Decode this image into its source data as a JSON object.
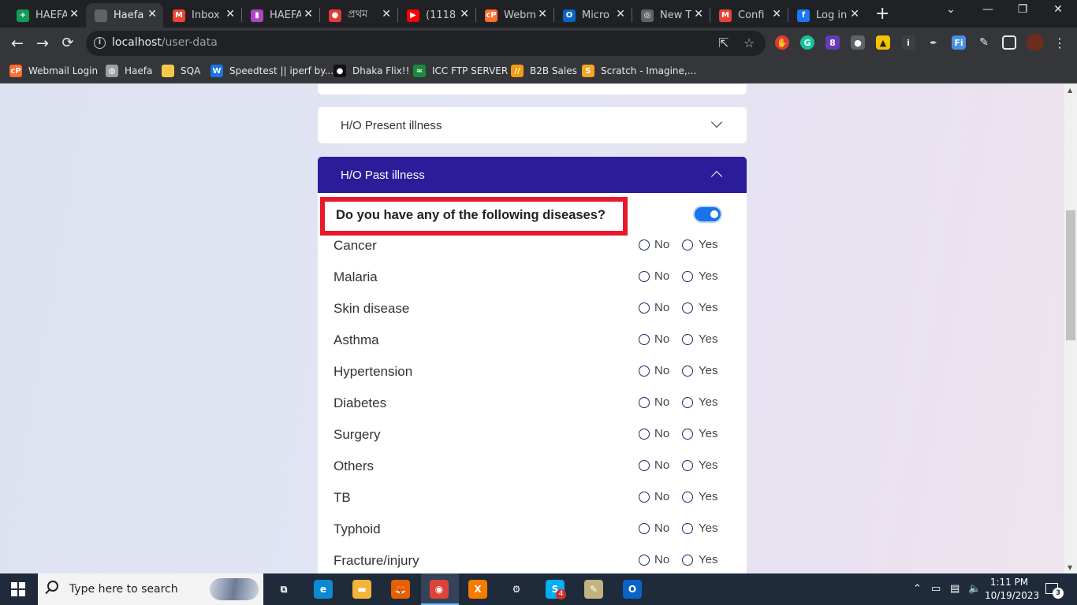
{
  "browser": {
    "tabs": [
      {
        "label": "HAEFA",
        "icon": "google-sheets-icon",
        "color": "#0f9d58",
        "glyph": "+"
      },
      {
        "label": "Haefa",
        "icon": "globe-icon",
        "color": "#5f6368",
        "glyph": ""
      },
      {
        "label": "Inbox",
        "icon": "gmail-icon",
        "color": "#ea4335",
        "glyph": "M"
      },
      {
        "label": "HAEFA",
        "icon": "trello-icon",
        "color": "#ab47bc",
        "glyph": "▮"
      },
      {
        "label": "প্রথম",
        "icon": "news-icon",
        "color": "#e53935",
        "glyph": "●"
      },
      {
        "label": "(1118",
        "icon": "youtube-icon",
        "color": "#ff0000",
        "glyph": "▶"
      },
      {
        "label": "Webm",
        "icon": "cpanel-icon",
        "color": "#ff6c2c",
        "glyph": "cP"
      },
      {
        "label": "Micro",
        "icon": "outlook-icon",
        "color": "#0a64c8",
        "glyph": "O"
      },
      {
        "label": "New T",
        "icon": "chrome-icon",
        "color": "#5f6368",
        "glyph": "◎"
      },
      {
        "label": "Confi",
        "icon": "gmail-icon",
        "color": "#ea4335",
        "glyph": "M"
      },
      {
        "label": "Log in",
        "icon": "facebook-icon",
        "color": "#1877f2",
        "glyph": "f"
      }
    ],
    "address": {
      "host": "localhost",
      "path": "/user-data"
    },
    "bookmarks": [
      {
        "label": "Webmail Login",
        "icon": "cpanel-icon",
        "color": "#ff6c2c",
        "glyph": "cP"
      },
      {
        "label": "Haefa",
        "icon": "globe-icon",
        "color": "#9aa0a6",
        "glyph": "◍"
      },
      {
        "label": "SQA",
        "icon": "folder-icon",
        "color": "#f2c94c",
        "glyph": ""
      },
      {
        "label": "Speedtest || iperf by...",
        "icon": "speedtest-icon",
        "color": "#1a73e8",
        "glyph": "W"
      },
      {
        "label": "Dhaka Flix!!",
        "icon": "dhakaflix-icon",
        "color": "#111111",
        "glyph": "●"
      },
      {
        "label": "ICC FTP SERVER",
        "icon": "icc-icon",
        "color": "#1b8a3a",
        "glyph": "≈"
      },
      {
        "label": "B2B Sales",
        "icon": "b2b-icon",
        "color": "#f39c12",
        "glyph": "//"
      },
      {
        "label": "Scratch - Imagine,...",
        "icon": "scratch-icon",
        "color": "#f5a623",
        "glyph": "S"
      }
    ]
  },
  "page": {
    "present_illness_title": "H/O Present illness",
    "past_illness_title": "H/O Past illness",
    "question": "Do you have any of the following diseases?",
    "toggle_on": true,
    "option_no": "No",
    "option_yes": "Yes",
    "diseases": [
      "Cancer",
      "Malaria",
      "Skin disease",
      "Asthma",
      "Hypertension",
      "Diabetes",
      "Surgery",
      "Others",
      "TB",
      "Typhoid",
      "Fracture/injury"
    ]
  },
  "taskbar": {
    "search_placeholder": "Type here to search",
    "apps": [
      {
        "name": "task-view-icon",
        "color": "#1f2a3a",
        "glyph": "⧉"
      },
      {
        "name": "edge-icon",
        "color": "#0c8ad1",
        "glyph": "e"
      },
      {
        "name": "file-explorer-icon",
        "color": "#f2b53a",
        "glyph": "▬"
      },
      {
        "name": "firefox-icon",
        "color": "#e66000",
        "glyph": "🦊"
      },
      {
        "name": "chrome-icon",
        "color": "#db4437",
        "glyph": "◉"
      },
      {
        "name": "xampp-icon",
        "color": "#f57c00",
        "glyph": "X"
      },
      {
        "name": "settings-icon",
        "color": "#1f2a3a",
        "glyph": "⚙"
      },
      {
        "name": "skype-icon",
        "color": "#00aff0",
        "glyph": "S"
      },
      {
        "name": "notepad-icon",
        "color": "#c2b280",
        "glyph": "✎"
      },
      {
        "name": "outlook-icon",
        "color": "#0a64c8",
        "glyph": "O"
      }
    ],
    "time": "1:11 PM",
    "date": "10/19/2023",
    "notifications": "3",
    "skype_badge": "4"
  }
}
